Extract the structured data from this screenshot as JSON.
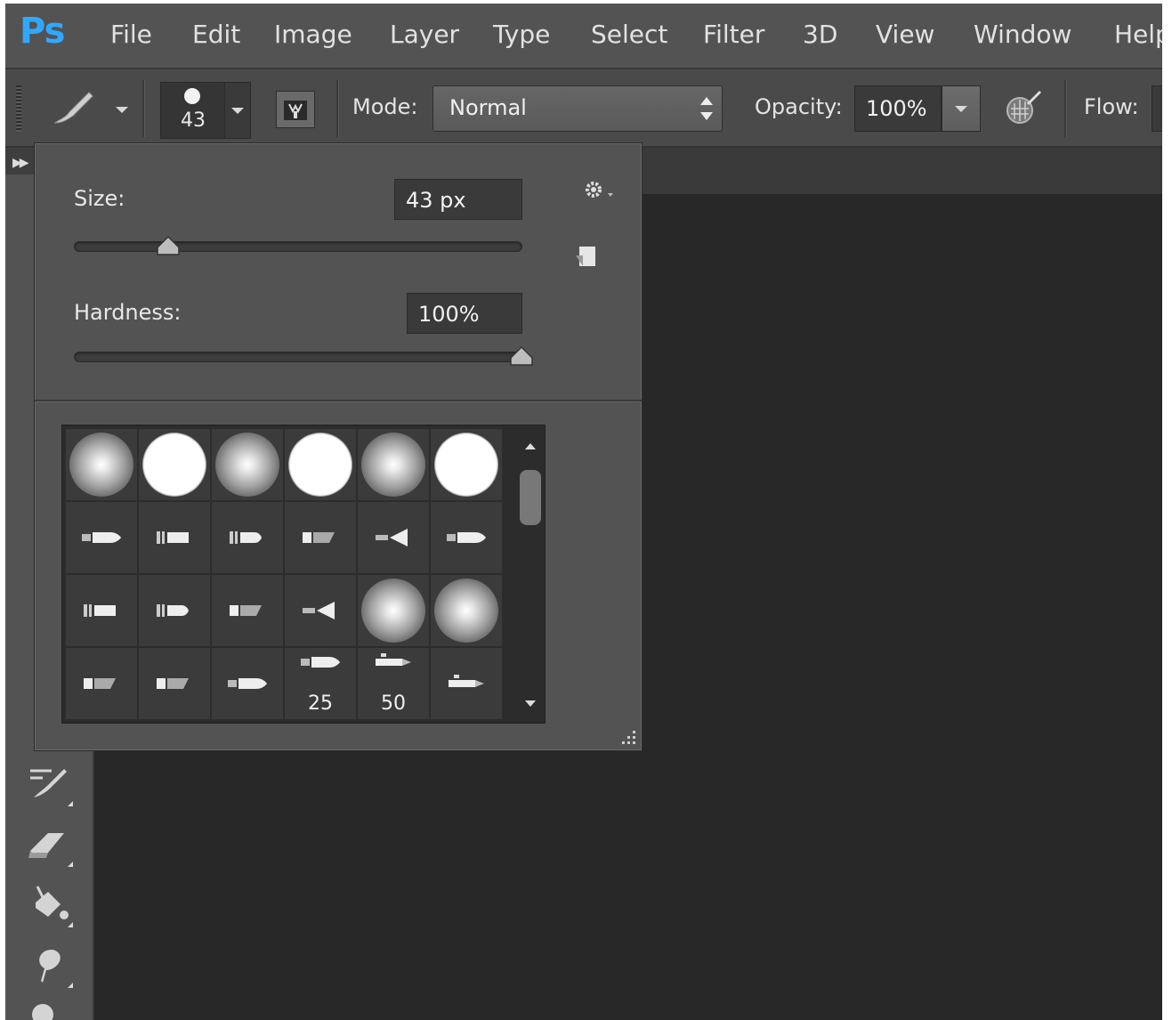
{
  "app": {
    "logo_text": "Ps"
  },
  "menu": [
    "File",
    "Edit",
    "Image",
    "Layer",
    "Type",
    "Select",
    "Filter",
    "3D",
    "View",
    "Window",
    "Help"
  ],
  "options_bar": {
    "brush_size": "43",
    "mode_label": "Mode:",
    "mode_value": "Normal",
    "opacity_label": "Opacity:",
    "opacity_value": "100%",
    "flow_label": "Flow:"
  },
  "brush_panel": {
    "size_label": "Size:",
    "size_value": "43 px",
    "size_slider_fraction": 0.21,
    "hardness_label": "Hardness:",
    "hardness_value": "100%",
    "hardness_slider_fraction": 1.0,
    "presets": [
      [
        "soft",
        "hard",
        "soft",
        "hard",
        "soft",
        "hard"
      ],
      [
        "tip-round",
        "tip-flat",
        "tip-flat-round",
        "tip-angled",
        "tip-fan",
        "tip-round"
      ],
      [
        "tip-flat",
        "tip-flat-round",
        "tip-angled",
        "tip-fan",
        "soft-large",
        "soft-large"
      ],
      [
        "tip-angled",
        "tip-angled",
        "tip-round",
        "tip-round",
        "tip-pen",
        "tip-pen"
      ]
    ],
    "preset_numbers": {
      "3-3": "25",
      "3-4": "50"
    }
  },
  "toolbar": {
    "tools": [
      "history-brush-icon",
      "eraser-icon",
      "paint-bucket-icon",
      "smudge-icon",
      "dodge-icon"
    ]
  },
  "colors": {
    "accent": "#31a8ff",
    "panel_bg": "#535353",
    "canvas_bg": "#282828"
  }
}
